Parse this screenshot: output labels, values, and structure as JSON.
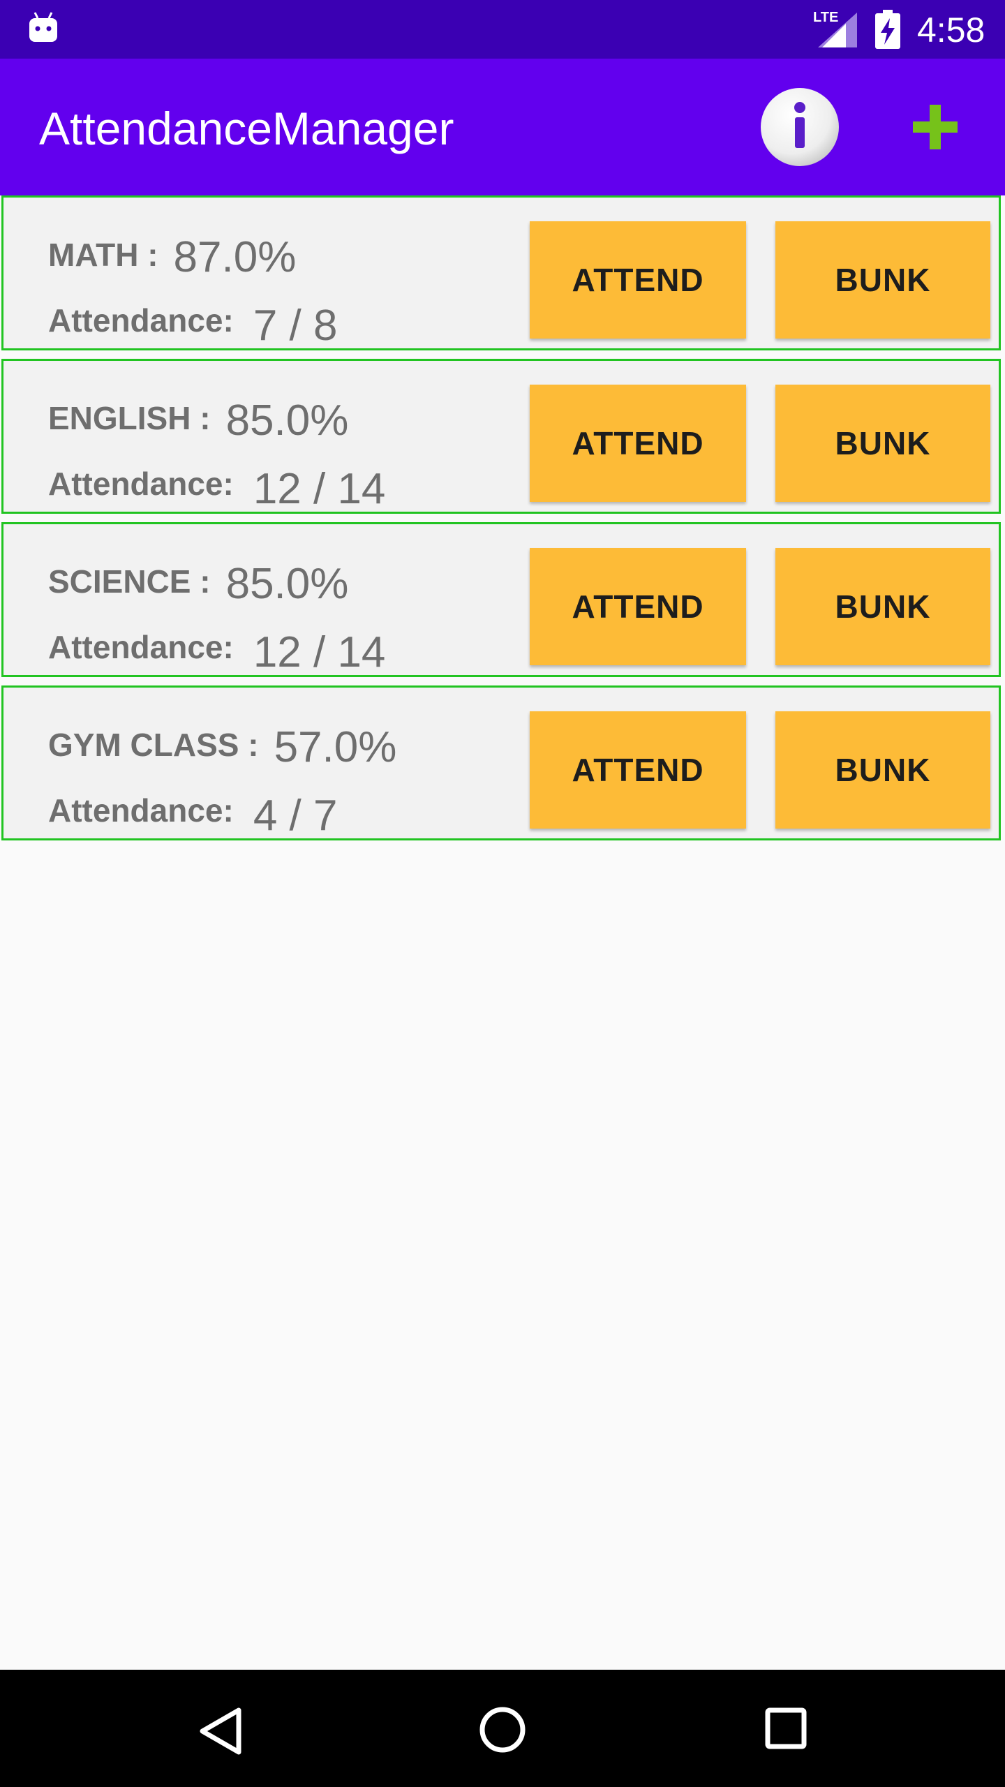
{
  "status_bar": {
    "network": "LTE",
    "time": "4:58",
    "icons": [
      "android-icon",
      "signal-icon",
      "battery-charging-icon"
    ]
  },
  "app_bar": {
    "title": "AttendanceManager",
    "actions": [
      "info-icon",
      "add-icon"
    ],
    "colors": {
      "bar": "#6200ee",
      "status": "#3b00b3",
      "add": "#76c21a"
    }
  },
  "subjects": [
    {
      "name": "MATH :",
      "percent": "87.0%",
      "attendance_label": "Attendance:",
      "attendance": "7 / 8",
      "attend_label": "ATTEND",
      "bunk_label": "BUNK"
    },
    {
      "name": "ENGLISH :",
      "percent": "85.0%",
      "attendance_label": "Attendance:",
      "attendance": "12 / 14",
      "attend_label": "ATTEND",
      "bunk_label": "BUNK"
    },
    {
      "name": "SCIENCE :",
      "percent": "85.0%",
      "attendance_label": "Attendance:",
      "attendance": "12 / 14",
      "attend_label": "ATTEND",
      "bunk_label": "BUNK"
    },
    {
      "name": "GYM CLASS :",
      "percent": "57.0%",
      "attendance_label": "Attendance:",
      "attendance": "4 / 7",
      "attend_label": "ATTEND",
      "bunk_label": "BUNK"
    }
  ],
  "theme": {
    "button": "#fdbb37",
    "card_border": "#22c422",
    "card_bg": "#f2f2f2"
  },
  "nav_bar": {
    "icons": [
      "back-icon",
      "home-icon",
      "recents-icon"
    ]
  }
}
